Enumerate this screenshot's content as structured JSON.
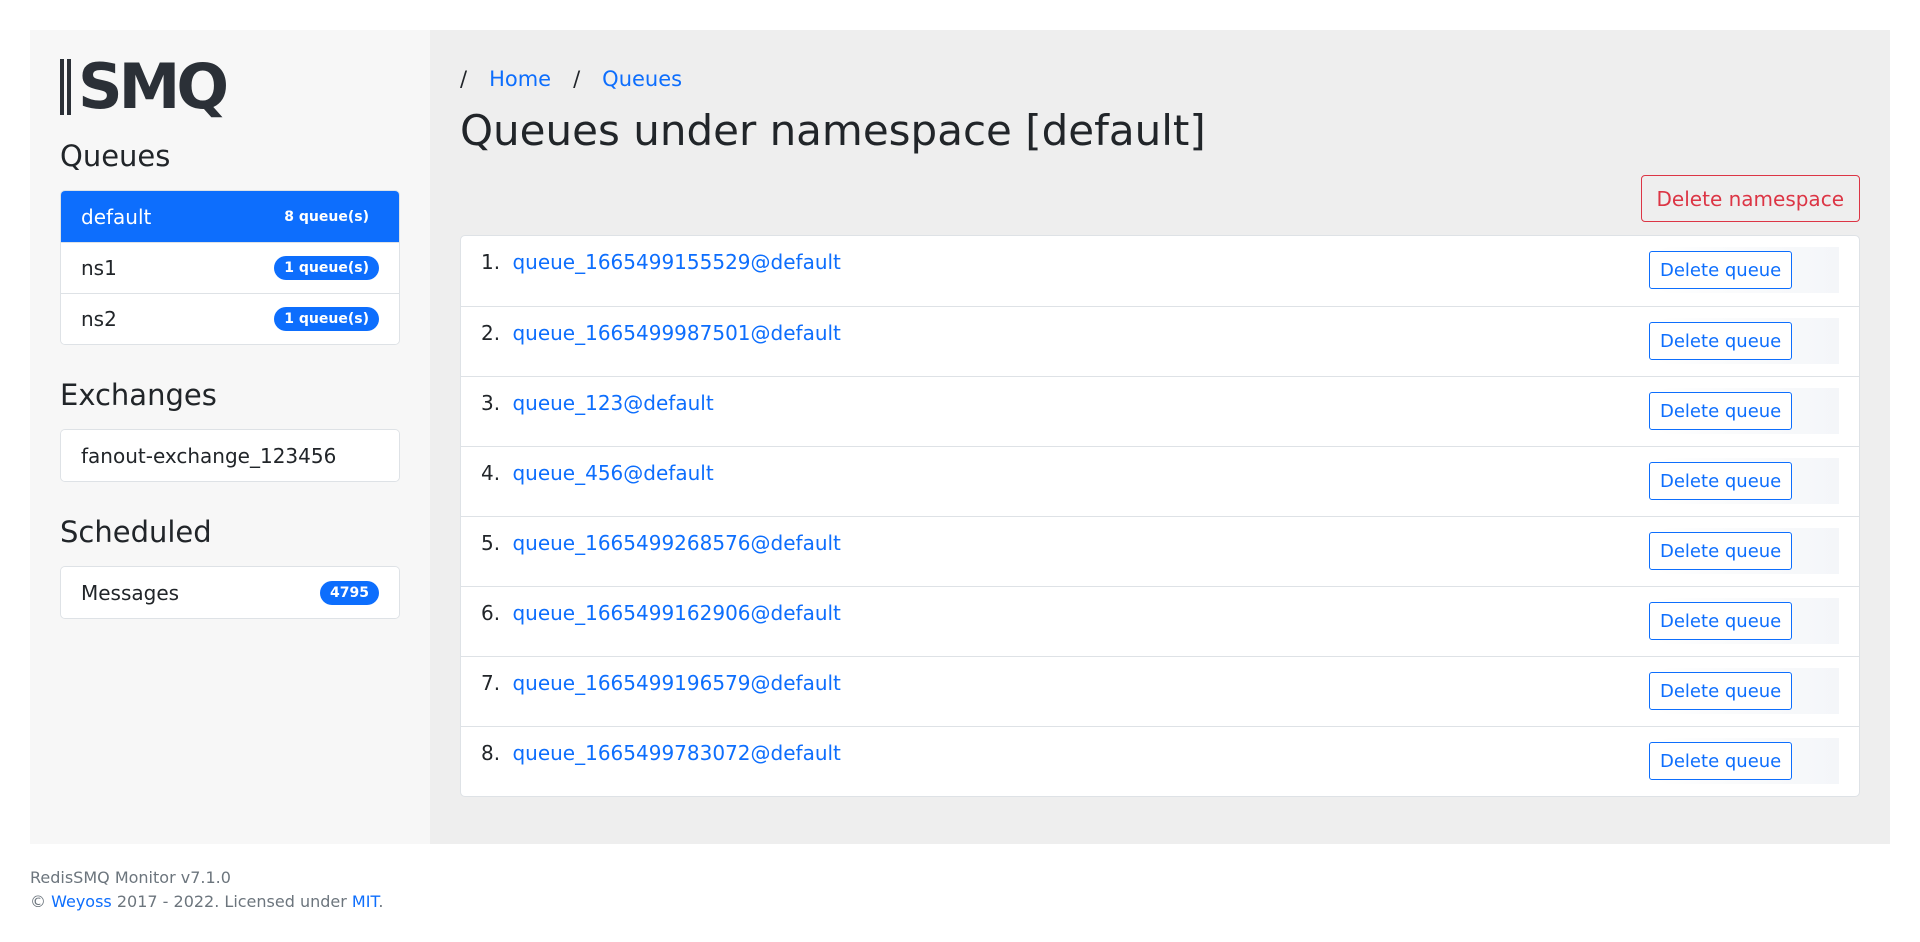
{
  "logo": {
    "text": "SMQ"
  },
  "sidebar": {
    "queues_title": "Queues",
    "namespaces": [
      {
        "name": "default",
        "badge": "8 queue(s)",
        "active": true
      },
      {
        "name": "ns1",
        "badge": "1 queue(s)",
        "active": false
      },
      {
        "name": "ns2",
        "badge": "1 queue(s)",
        "active": false
      }
    ],
    "exchanges_title": "Exchanges",
    "exchanges": [
      {
        "name": "fanout-exchange_123456"
      }
    ],
    "scheduled_title": "Scheduled",
    "scheduled": {
      "label": "Messages",
      "count": "4795"
    }
  },
  "breadcrumb": {
    "separator": "/",
    "items": [
      "Home",
      "Queues"
    ]
  },
  "main": {
    "title": "Queues under namespace [default]",
    "delete_namespace_label": "Delete namespace",
    "delete_queue_label": "Delete queue",
    "queues": [
      {
        "num": "1.",
        "name": "queue_1665499155529@default"
      },
      {
        "num": "2.",
        "name": "queue_1665499987501@default"
      },
      {
        "num": "3.",
        "name": "queue_123@default"
      },
      {
        "num": "4.",
        "name": "queue_456@default"
      },
      {
        "num": "5.",
        "name": "queue_1665499268576@default"
      },
      {
        "num": "6.",
        "name": "queue_1665499162906@default"
      },
      {
        "num": "7.",
        "name": "queue_1665499196579@default"
      },
      {
        "num": "8.",
        "name": "queue_1665499783072@default"
      }
    ]
  },
  "footer": {
    "version": "RedisSMQ Monitor v7.1.0",
    "copyright_symbol": "©",
    "author": "Weyoss",
    "years_text": "2017 - 2022. Licensed under",
    "license": "MIT",
    "period": "."
  },
  "colors": {
    "primary": "#0d6efd",
    "danger": "#dc3545",
    "sidebar_bg": "#f7f7f7",
    "main_bg": "#eeeeee"
  }
}
